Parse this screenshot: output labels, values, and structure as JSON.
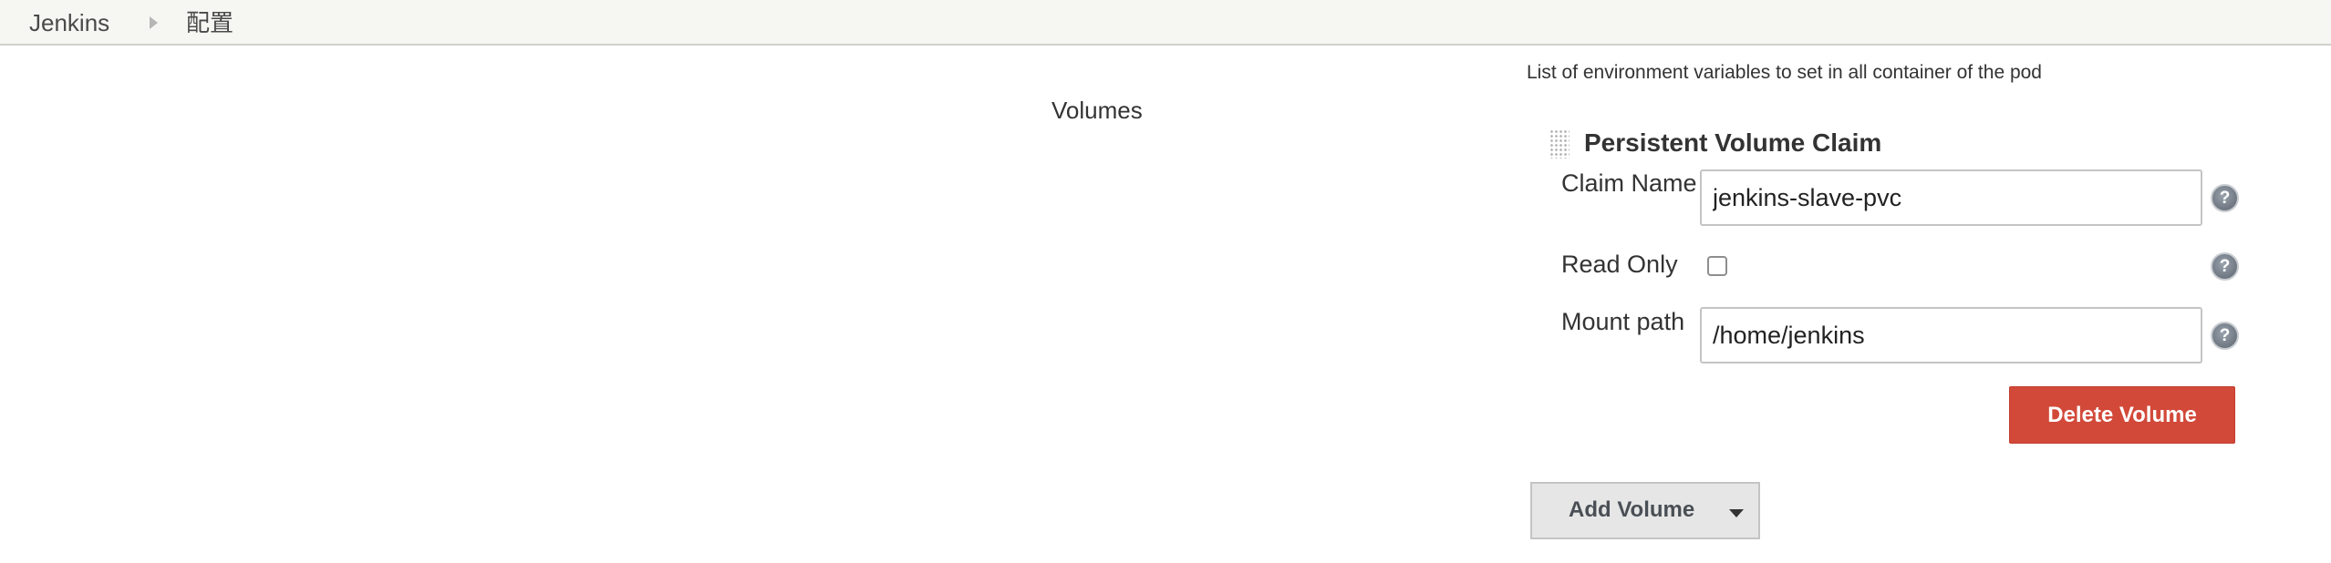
{
  "breadcrumb": {
    "home": "Jenkins",
    "current": "配置"
  },
  "env_hint": "List of environment variables to set in all container of the pod",
  "volumes_section": {
    "label": "Volumes",
    "persistent_volume_claim": {
      "title": "Persistent Volume Claim",
      "claim_name": {
        "label": "Claim Name",
        "value": "jenkins-slave-pvc"
      },
      "read_only": {
        "label": "Read Only",
        "checked": false
      },
      "mount_path": {
        "label": "Mount path",
        "value": "/home/jenkins"
      },
      "delete_label": "Delete Volume"
    },
    "add_label": "Add Volume"
  },
  "help_glyph": "?",
  "icons": {
    "breadcrumb_separator": "chevron-right-icon",
    "drag_handle": "drag-handle-icon",
    "help": "help-icon",
    "dropdown": "caret-down-icon"
  },
  "colors": {
    "delete_button": "#d24939",
    "breadcrumb_bar": "#f6f7f2",
    "add_button": "#e6e6e6"
  }
}
